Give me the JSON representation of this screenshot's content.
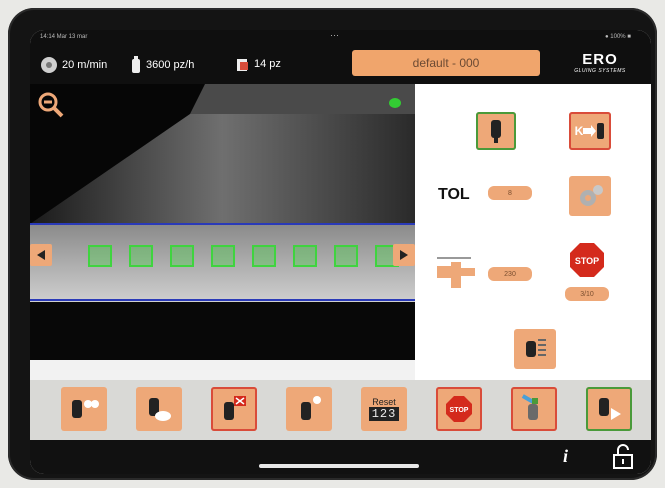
{
  "status_bar": {
    "time": "14:14 Mar 13 mar",
    "battery": "● 100% ■"
  },
  "topbar": {
    "speed": "20 m/min",
    "rate": "3600 pz/h",
    "pieces": "14 pz",
    "title": "default - 000"
  },
  "logo": {
    "brand": "ERO",
    "tagline": "GLUING SYSTEMS"
  },
  "camera": {
    "zoom_icon": "zoom-out-icon",
    "indicator_color": "#33cc33",
    "marker_count": 8,
    "line_color": "#2a3ab8",
    "marker_color": "#3fd43f"
  },
  "controls": {
    "tol_label": "TOL",
    "tol_value": "8",
    "offset_value": "230",
    "stop_label": "STOP",
    "stop_counter": "3/10",
    "k_label": "K"
  },
  "toolbar": {
    "reset_label": "Reset",
    "reset_digits": "123",
    "stop_label": "STOP"
  },
  "footer": {
    "info_label": "i"
  },
  "colors": {
    "accent": "#eea878",
    "dark": "#111111",
    "stop_red": "#d42a1c"
  }
}
